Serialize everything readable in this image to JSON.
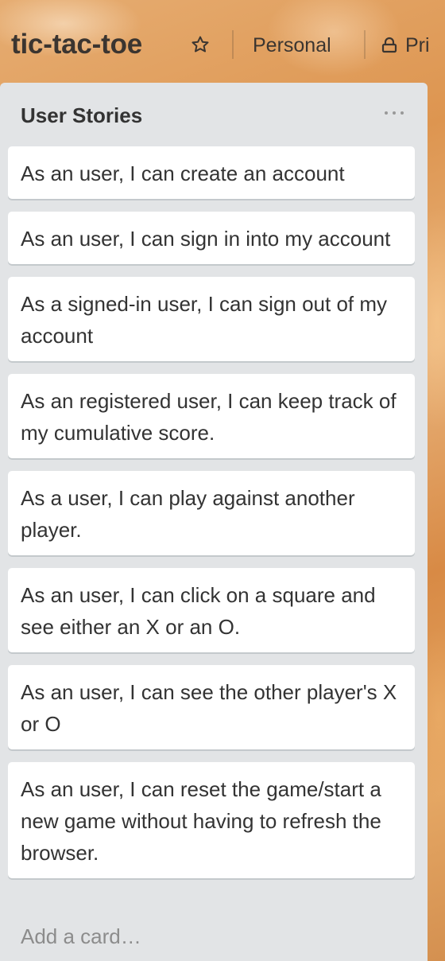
{
  "board": {
    "title": "tic-tac-toe",
    "star_icon": "star-icon",
    "team": "Personal",
    "privacy": "Pri",
    "privacy_icon": "lock-icon"
  },
  "list": {
    "title": "User Stories",
    "menu_icon": "more-icon",
    "cards": [
      "As an user, I can create an account",
      "As an user, I can sign in into my account",
      "As a signed-in user, I can sign out of my account",
      "As an registered user, I can keep track of my cumulative score.",
      "As a user, I can play against another player.",
      "As an user, I can click on a square and see either an X or an O.",
      "As an user, I can see the other player's X or O",
      "As an user, I can reset the game/start a new game without having to refresh the browser."
    ],
    "add_card": "Add a card…"
  },
  "colors": {
    "list_bg": "#e2e4e6",
    "card_bg": "#ffffff",
    "text": "#333333",
    "muted": "#8c8c8c"
  }
}
